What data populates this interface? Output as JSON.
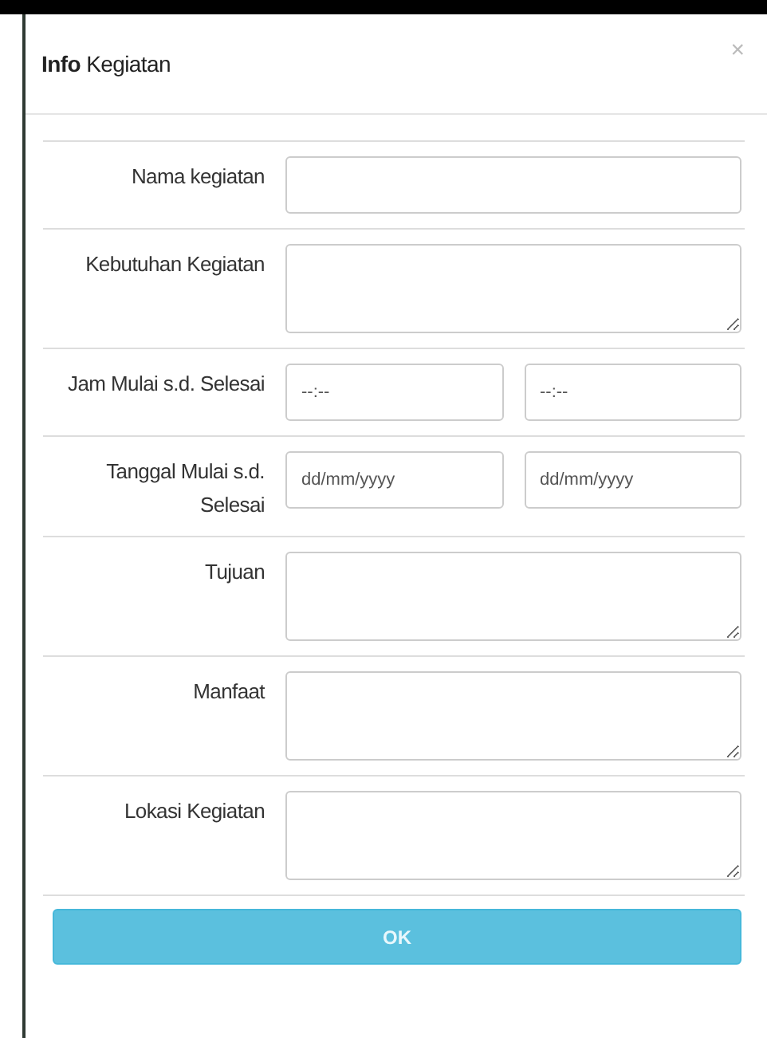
{
  "dialog": {
    "title_bold": "Info",
    "title": "Kegiatan",
    "close": "×"
  },
  "fields": [
    {
      "label": "Nama kegiatan",
      "kind": "text"
    },
    {
      "label": "Kebutuhan Kegiatan",
      "kind": "textarea"
    },
    {
      "label": "Jam Mulai s.d. Selesai",
      "kind": "pair",
      "placeholders": [
        "--:--",
        "--:--"
      ]
    },
    {
      "label": "Tanggal Mulai s.d. Selesai",
      "kind": "pair",
      "placeholders": [
        "dd/mm/yyyy",
        "dd/mm/yyyy"
      ]
    },
    {
      "label": "Tujuan",
      "kind": "textarea"
    },
    {
      "label": "Manfaat",
      "kind": "textarea"
    },
    {
      "label": "Lokasi Kegiatan",
      "kind": "textarea"
    }
  ],
  "buttons": [
    "OK"
  ]
}
